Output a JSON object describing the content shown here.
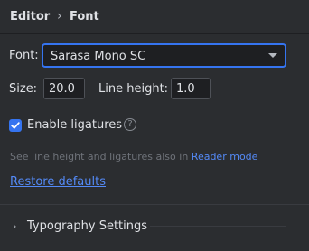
{
  "breadcrumb": {
    "parent": "Editor",
    "separator": "›",
    "current": "Font"
  },
  "font": {
    "label": "Font:",
    "selected": "Sarasa Mono SC"
  },
  "size": {
    "label": "Size:",
    "value": "20.0"
  },
  "line_height": {
    "label": "Line height:",
    "value": "1.0"
  },
  "ligatures": {
    "label": "Enable ligatures",
    "checked": true,
    "help_icon": "question-circle-icon"
  },
  "hint": {
    "text": "See line height and ligatures also in ",
    "link": "Reader mode"
  },
  "restore_defaults": "Restore defaults",
  "typography": {
    "label": "Typography Settings",
    "chevron": "›"
  },
  "colors": {
    "accent": "#3574f0",
    "link": "#548af7",
    "background": "#2b2d30"
  }
}
